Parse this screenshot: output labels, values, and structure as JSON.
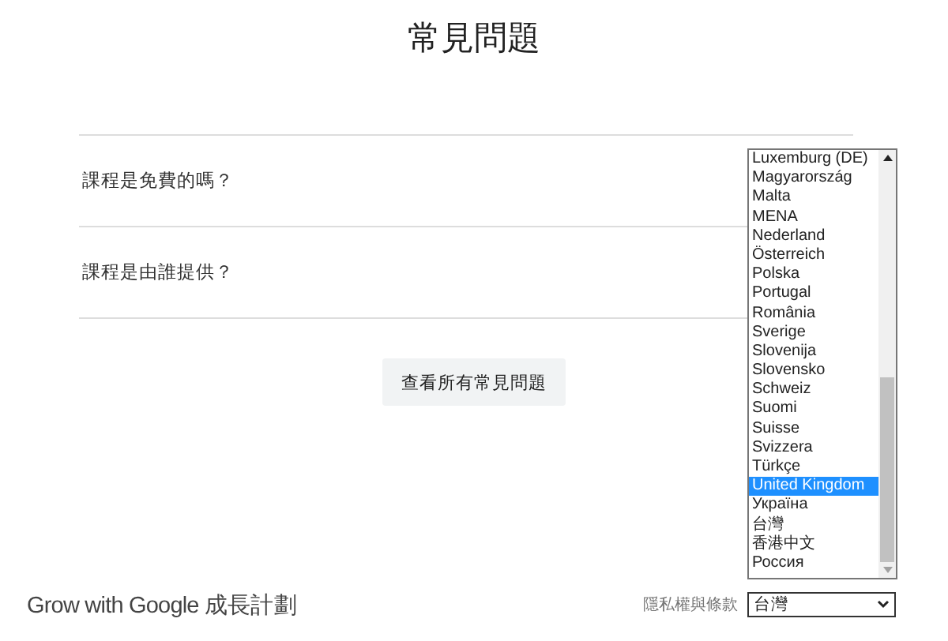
{
  "title": "常見問題",
  "questions": [
    {
      "text": "課程是免費的嗎？"
    },
    {
      "text": "課程是由誰提供？"
    }
  ],
  "all_faq_button": "查看所有常見問題",
  "footer": {
    "brand": "Grow with Google 成長計劃",
    "privacy_link": "隱私權與條款",
    "country_select": {
      "value": "台灣"
    }
  },
  "country_list": [
    {
      "label": "Luxemburg (DE)",
      "selected": false
    },
    {
      "label": "Magyarország",
      "selected": false
    },
    {
      "label": "Malta",
      "selected": false
    },
    {
      "label": "MENA",
      "selected": false
    },
    {
      "label": "Nederland",
      "selected": false
    },
    {
      "label": "Österreich",
      "selected": false
    },
    {
      "label": "Polska",
      "selected": false
    },
    {
      "label": "Portugal",
      "selected": false
    },
    {
      "label": "România",
      "selected": false
    },
    {
      "label": "Sverige",
      "selected": false
    },
    {
      "label": "Slovenija",
      "selected": false
    },
    {
      "label": "Slovensko",
      "selected": false
    },
    {
      "label": "Schweiz",
      "selected": false
    },
    {
      "label": "Suomi",
      "selected": false
    },
    {
      "label": "Suisse",
      "selected": false
    },
    {
      "label": "Svizzera",
      "selected": false
    },
    {
      "label": "Türkçe",
      "selected": false
    },
    {
      "label": "United Kingdom",
      "selected": true
    },
    {
      "label": "Україна",
      "selected": false
    },
    {
      "label": "台灣",
      "selected": false
    },
    {
      "label": "香港中文",
      "selected": false
    },
    {
      "label": "Россия",
      "selected": false
    }
  ]
}
